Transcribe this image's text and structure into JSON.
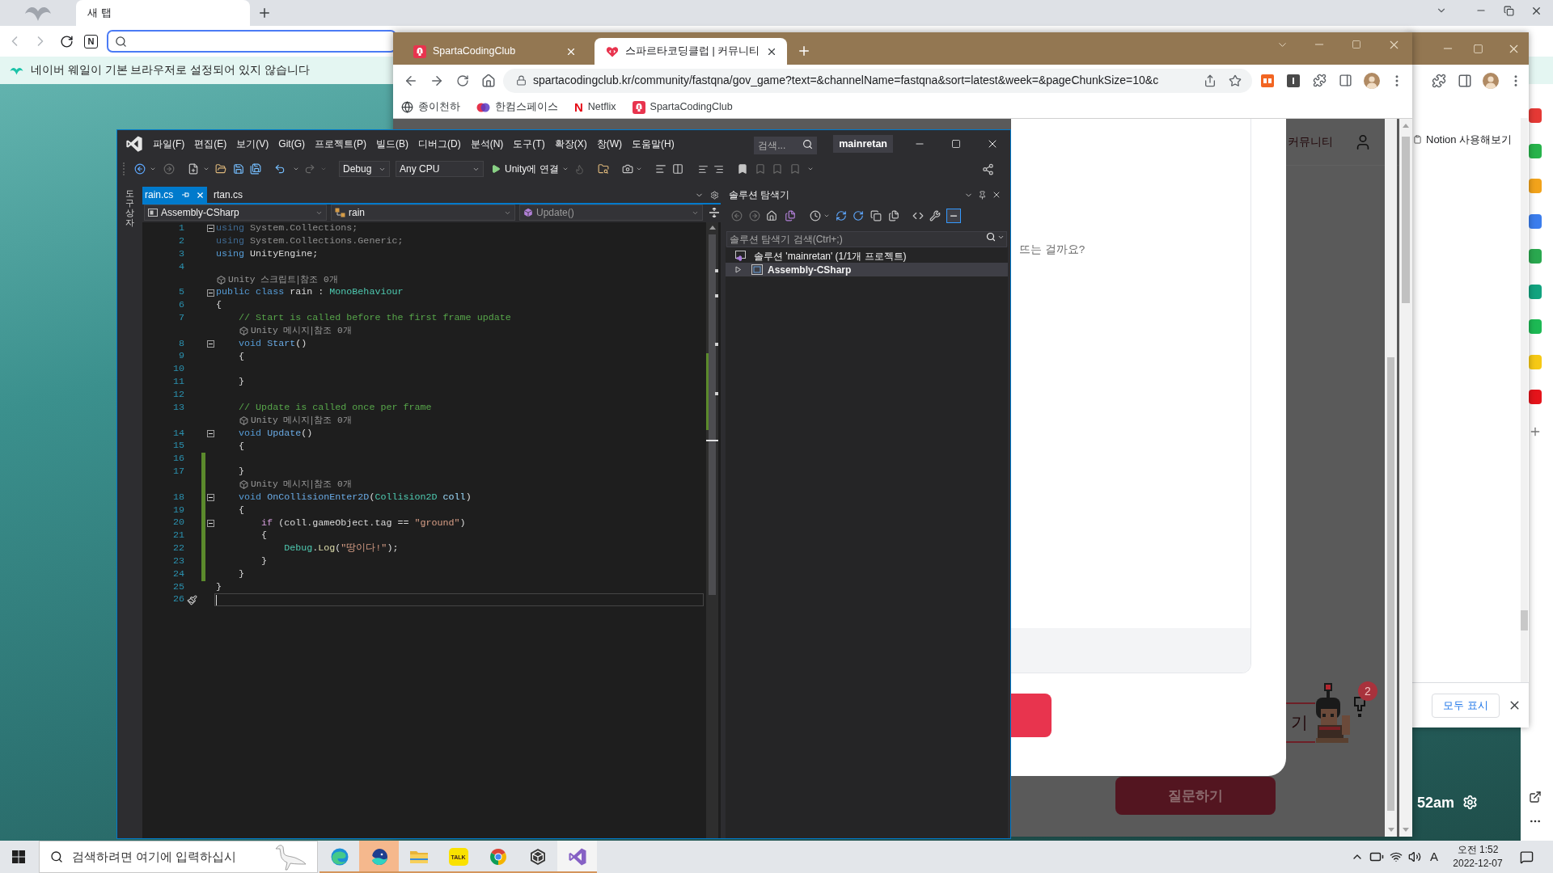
{
  "whale": {
    "tabs": [
      {
        "label": "새 탭",
        "selected": true
      }
    ],
    "logo_glyph": "N",
    "notice": "네이버 웨일이 기본 브라우저로 설정되어 있지 않습니다",
    "clock": "52am",
    "sidebar_apps": [
      {
        "color": "#e53935"
      },
      {
        "color": "#27b34b"
      },
      {
        "color": "#f2a31b"
      },
      {
        "color": "#3b7ded"
      },
      {
        "color": "#2aa84f"
      },
      {
        "color": "#12a37f"
      },
      {
        "color": "#1db954"
      },
      {
        "color": "#f6c915"
      },
      {
        "color": "#e5141b"
      }
    ]
  },
  "chrome_back": {
    "page_title": "Notion 사용해보기",
    "download_bar": {
      "show_all": "모두 표시"
    }
  },
  "chrome_front": {
    "tabs": [
      {
        "label": "SpartaCodingClub",
        "kind": "sparta",
        "selected": false
      },
      {
        "label": "스파르타코딩클럽 | 커뮤니티",
        "kind": "community",
        "selected": true
      }
    ],
    "url": "spartacodingclub.kr/community/fastqna/gov_game?text=&channelName=fastqna&sort=latest&week=&pageChunkSize=10&c",
    "bookmarks": [
      {
        "label": "종이천하",
        "kind": "globe"
      },
      {
        "label": "한컴스페이스",
        "kind": "hancom"
      },
      {
        "label": "Netflix",
        "kind": "netflix",
        "glyph": "N"
      },
      {
        "label": "SpartaCodingClub",
        "kind": "sparta"
      }
    ],
    "page": {
      "nav_link": "커뮤니티",
      "modal_text": "뜨는 걸까요?",
      "partial_button": "기",
      "badge": "2",
      "ask_button": "질문하기"
    }
  },
  "vs": {
    "menu": [
      "파일(F)",
      "편집(E)",
      "보기(V)",
      "Git(G)",
      "프로젝트(P)",
      "빌드(B)",
      "디버그(D)",
      "분석(N)",
      "도구(T)",
      "확장(X)",
      "창(W)",
      "도움말(H)"
    ],
    "search_placeholder": "검색...",
    "solution_name": "mainretan",
    "configuration": "Debug",
    "platform": "Any CPU",
    "run_label": "Unity에 연결",
    "toolbox_label": "도구 상자",
    "doc_tabs": [
      {
        "label": "rain.cs",
        "selected": true
      },
      {
        "label": "rtan.cs",
        "selected": false
      }
    ],
    "nav": [
      {
        "label": "Assembly-CSharp",
        "kind": "project"
      },
      {
        "label": "rain",
        "kind": "class"
      },
      {
        "label": "Update()",
        "kind": "method"
      }
    ],
    "editor": {
      "rows": [
        {
          "kind": "code",
          "number": "1",
          "foldable": true,
          "changed": false,
          "current": false,
          "tokens": [
            {
              "kind": "keyword_faded",
              "text": "using"
            },
            {
              "kind": "plain_faded",
              "text": " System.Collections;"
            }
          ]
        },
        {
          "kind": "code",
          "number": "2",
          "foldable": false,
          "changed": false,
          "current": false,
          "tokens": [
            {
              "kind": "keyword_faded",
              "text": "using"
            },
            {
              "kind": "plain_faded",
              "text": " System.Collections.Generic;"
            }
          ]
        },
        {
          "kind": "code",
          "number": "3",
          "foldable": false,
          "changed": false,
          "current": false,
          "tokens": [
            {
              "kind": "keyword",
              "text": "using"
            },
            {
              "kind": "plain",
              "text": " UnityEngine;"
            }
          ]
        },
        {
          "kind": "code",
          "number": "4",
          "foldable": false,
          "changed": false,
          "current": false
        },
        {
          "kind": "codelens",
          "changed": false,
          "items": [
            "Unity 스크립트",
            "참조 0개"
          ]
        },
        {
          "kind": "code",
          "number": "5",
          "foldable": true,
          "changed": false,
          "current": false,
          "tokens": [
            {
              "kind": "keyword",
              "text": "public class"
            },
            {
              "kind": "plain",
              "text": " rain : "
            },
            {
              "kind": "type",
              "text": "MonoBehaviour"
            }
          ]
        },
        {
          "kind": "code",
          "number": "6",
          "foldable": false,
          "changed": false,
          "current": false,
          "tokens": [
            {
              "kind": "plain",
              "text": "{"
            }
          ]
        },
        {
          "kind": "code",
          "number": "7",
          "foldable": false,
          "changed": false,
          "current": false,
          "tokens": [
            {
              "kind": "comment",
              "text": "    // Start is called before the first frame update"
            }
          ]
        },
        {
          "kind": "codelens",
          "changed": false,
          "items": [
            "Unity 메시지",
            "참조 0개"
          ]
        },
        {
          "kind": "code",
          "number": "8",
          "foldable": true,
          "changed": false,
          "current": false,
          "tokens": [
            {
              "kind": "keyword",
              "text": "    void "
            },
            {
              "kind": "message",
              "text": "Start"
            },
            {
              "kind": "plain",
              "text": "()"
            }
          ]
        },
        {
          "kind": "code",
          "number": "9",
          "foldable": false,
          "changed": false,
          "current": false,
          "tokens": [
            {
              "kind": "plain",
              "text": "    {"
            }
          ]
        },
        {
          "kind": "code",
          "number": "10",
          "foldable": false,
          "changed": false,
          "current": false
        },
        {
          "kind": "code",
          "number": "11",
          "foldable": false,
          "changed": false,
          "current": false,
          "tokens": [
            {
              "kind": "plain",
              "text": "    }"
            }
          ]
        },
        {
          "kind": "code",
          "number": "12",
          "foldable": false,
          "changed": false,
          "current": false
        },
        {
          "kind": "code",
          "number": "13",
          "foldable": false,
          "changed": false,
          "current": false,
          "tokens": [
            {
              "kind": "comment",
              "text": "    // Update is called once per frame"
            }
          ]
        },
        {
          "kind": "codelens",
          "changed": false,
          "items": [
            "Unity 메시지",
            "참조 0개"
          ]
        },
        {
          "kind": "code",
          "number": "14",
          "foldable": true,
          "changed": false,
          "current": false,
          "tokens": [
            {
              "kind": "keyword",
              "text": "    void "
            },
            {
              "kind": "message",
              "text": "Update"
            },
            {
              "kind": "plain",
              "text": "()"
            }
          ]
        },
        {
          "kind": "code",
          "number": "15",
          "foldable": false,
          "changed": false,
          "current": false,
          "tokens": [
            {
              "kind": "plain",
              "text": "    {"
            }
          ]
        },
        {
          "kind": "code",
          "number": "16",
          "foldable": false,
          "changed": true,
          "current": false
        },
        {
          "kind": "code",
          "number": "17",
          "foldable": false,
          "changed": true,
          "current": false,
          "tokens": [
            {
              "kind": "plain",
              "text": "    }"
            }
          ]
        },
        {
          "kind": "codelens",
          "changed": true,
          "items": [
            "Unity 메시지",
            "참조 0개"
          ]
        },
        {
          "kind": "code",
          "number": "18",
          "foldable": true,
          "changed": true,
          "current": false,
          "tokens": [
            {
              "kind": "keyword",
              "text": "    void "
            },
            {
              "kind": "message",
              "text": "OnCollisionEnter2D"
            },
            {
              "kind": "plain",
              "text": "("
            },
            {
              "kind": "type",
              "text": "Collision2D"
            },
            {
              "kind": "parameter",
              "text": " coll"
            },
            {
              "kind": "plain",
              "text": ")"
            }
          ]
        },
        {
          "kind": "code",
          "number": "19",
          "foldable": false,
          "changed": true,
          "current": false,
          "tokens": [
            {
              "kind": "plain",
              "text": "    {"
            }
          ]
        },
        {
          "kind": "code",
          "number": "20",
          "foldable": true,
          "changed": true,
          "current": false,
          "tokens": [
            {
              "kind": "control",
              "text": "        if"
            },
            {
              "kind": "plain",
              "text": " (coll.gameObject.tag == "
            },
            {
              "kind": "string",
              "text": "\"ground\""
            },
            {
              "kind": "plain",
              "text": ")"
            }
          ]
        },
        {
          "kind": "code",
          "number": "21",
          "foldable": false,
          "changed": true,
          "current": false,
          "tokens": [
            {
              "kind": "plain",
              "text": "        {"
            }
          ]
        },
        {
          "kind": "code",
          "number": "22",
          "foldable": false,
          "changed": true,
          "current": false,
          "tokens": [
            {
              "kind": "type",
              "text": "            Debug"
            },
            {
              "kind": "plain",
              "text": "."
            },
            {
              "kind": "method",
              "text": "Log"
            },
            {
              "kind": "plain",
              "text": "("
            },
            {
              "kind": "string",
              "text": "\"땅이다!\""
            },
            {
              "kind": "plain",
              "text": ");"
            }
          ]
        },
        {
          "kind": "code",
          "number": "23",
          "foldable": false,
          "changed": true,
          "current": false,
          "tokens": [
            {
              "kind": "plain",
              "text": "        }"
            }
          ]
        },
        {
          "kind": "code",
          "number": "24",
          "foldable": false,
          "changed": true,
          "current": false,
          "tokens": [
            {
              "kind": "plain",
              "text": "    }"
            }
          ]
        },
        {
          "kind": "code",
          "number": "25",
          "foldable": false,
          "changed": false,
          "current": false,
          "tokens": [
            {
              "kind": "plain",
              "text": "}"
            }
          ]
        },
        {
          "kind": "code",
          "number": "26",
          "foldable": false,
          "changed": false,
          "current": true
        }
      ]
    },
    "solution_explorer": {
      "title": "솔루션 탐색기",
      "search_placeholder": "솔루션 탐색기 검색(Ctrl+;)",
      "tree": [
        {
          "label": "솔루션 'mainretan' (1/1개 프로젝트)",
          "kind": "solution",
          "selected": false,
          "children": [
            {
              "label": "Assembly-CSharp",
              "kind": "project",
              "selected": true,
              "expanded": false
            }
          ]
        }
      ]
    }
  },
  "taskbar": {
    "search_placeholder": "검색하려면 여기에 입력하십시",
    "apps": [
      {
        "kind": "swirl",
        "selected": false,
        "flashing": false,
        "running": true
      },
      {
        "kind": "whale",
        "selected": false,
        "flashing": true,
        "running": true
      },
      {
        "kind": "folder",
        "selected": false,
        "flashing": false,
        "running": true
      },
      {
        "kind": "chat",
        "glyph": "TALK",
        "selected": false,
        "flashing": false,
        "running": true
      },
      {
        "kind": "tricolor",
        "selected": false,
        "flashing": false,
        "running": true
      },
      {
        "kind": "cube",
        "selected": false,
        "flashing": false,
        "running": true
      },
      {
        "kind": "infinity",
        "selected": true,
        "flashing": false,
        "running": true
      }
    ],
    "ime": "A",
    "time": "오전 1:52",
    "date": "2022-12-07"
  }
}
